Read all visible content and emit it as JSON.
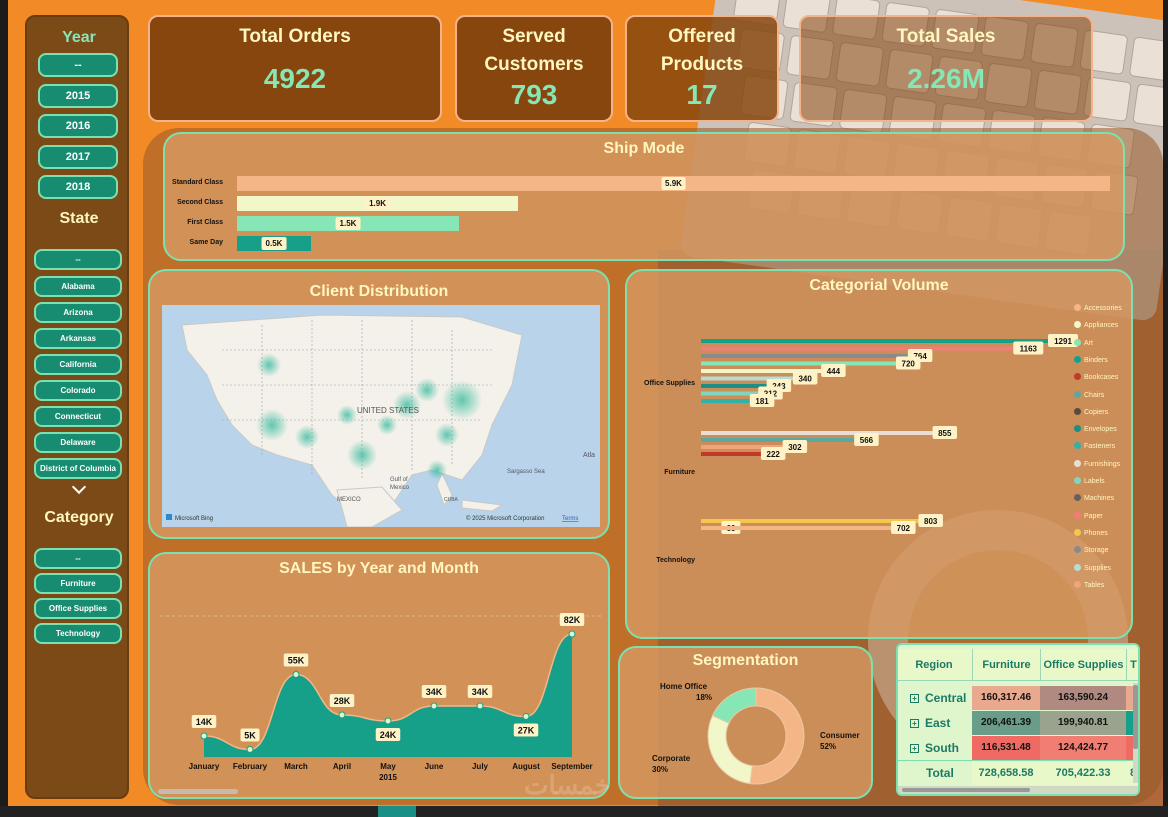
{
  "filters": {
    "year_title": "Year",
    "years": [
      "--",
      "2015",
      "2016",
      "2017",
      "2018"
    ],
    "state_title": "State",
    "states": [
      "--",
      "Alabama",
      "Arizona",
      "Arkansas",
      "California",
      "Colorado",
      "Connecticut",
      "Delaware",
      "District of Columbia"
    ],
    "category_title": "Category",
    "categories": [
      "--",
      "Furniture",
      "Office Supplies",
      "Technology"
    ]
  },
  "kpis": {
    "total_orders_label": "Total Orders",
    "total_orders_value": "4922",
    "served_customers_label": "Served Customers",
    "served_customers_value": "793",
    "offered_products_label": "Offered Products",
    "offered_products_value": "17",
    "total_sales_label": "Total Sales",
    "total_sales_value": "2.26M"
  },
  "ship_mode": {
    "title": "Ship Mode",
    "chart_data": {
      "type": "bar",
      "categories": [
        "Standard Class",
        "Second Class",
        "First Class",
        "Same Day"
      ],
      "values": [
        5900,
        1900,
        1500,
        500
      ],
      "data_labels": [
        "5.9K",
        "1.9K",
        "1.5K",
        "0.5K"
      ],
      "colors": [
        "#f5b687",
        "#f1f7c8",
        "#86e6b5",
        "#16a08a"
      ]
    }
  },
  "client_distribution": {
    "title": "Client Distribution",
    "map_labels": {
      "country": "UNITED STATES",
      "mexico": "MEXICO",
      "gulf": "Gulf of",
      "gulf2": "Mexico",
      "sea": "Sargasso Sea",
      "atlantic": "Atla",
      "cuba": "CUBA",
      "copyright": "© 2025 Microsoft Corporation",
      "terms": "Terms",
      "bing": "Microsoft Bing"
    }
  },
  "categorial_volume": {
    "title": "Categorial Volume",
    "chart_data": {
      "type": "bar",
      "categories": [
        "Office Supplies",
        "Furniture",
        "Technology"
      ],
      "series": [
        {
          "name": "Accessories",
          "color": "#f5b687",
          "values": [
            0,
            0,
            0
          ]
        },
        {
          "name": "Appliances",
          "color": "#f1f7c8",
          "values": [
            444,
            0,
            0
          ]
        },
        {
          "name": "Art",
          "color": "#86e6b5",
          "values": [
            720,
            0,
            0
          ]
        },
        {
          "name": "Binders",
          "color": "#16a08a",
          "values": [
            1291,
            0,
            0
          ]
        },
        {
          "name": "Bookcases",
          "color": "#c0392b",
          "values": [
            0,
            222,
            0
          ]
        },
        {
          "name": "Chairs",
          "color": "#5ba8a0",
          "values": [
            0,
            566,
            0
          ]
        },
        {
          "name": "Copiers",
          "color": "#5a4a3a",
          "values": [
            0,
            0,
            66
          ]
        },
        {
          "name": "Envelopes",
          "color": "#1a8f85",
          "values": [
            243,
            0,
            0
          ]
        },
        {
          "name": "Fasteners",
          "color": "#2fb3a5",
          "values": [
            181,
            0,
            0
          ]
        },
        {
          "name": "Furnishings",
          "color": "#e9ddd5",
          "values": [
            0,
            855,
            0
          ]
        },
        {
          "name": "Labels",
          "color": "#7fd7c2",
          "values": [
            212,
            0,
            0
          ]
        },
        {
          "name": "Machines",
          "color": "#6b5f5a",
          "values": [
            0,
            0,
            0
          ]
        },
        {
          "name": "Paper",
          "color": "#f07e78",
          "values": [
            1163,
            0,
            0
          ]
        },
        {
          "name": "Phones",
          "color": "#f3c84a",
          "values": [
            0,
            0,
            803
          ]
        },
        {
          "name": "Storage",
          "color": "#8a8a8a",
          "values": [
            764,
            0,
            0
          ]
        },
        {
          "name": "Supplies",
          "color": "#b7dbd5",
          "values": [
            340,
            0,
            0
          ]
        },
        {
          "name": "Tables",
          "color": "#f3a37a",
          "values": [
            0,
            302,
            0
          ]
        }
      ],
      "office_labels": [
        "1291",
        "1163",
        "764",
        "720",
        "444",
        "340",
        "243",
        "212",
        "181"
      ],
      "furniture_labels": [
        "855",
        "566",
        "302",
        "222"
      ],
      "technology_labels": [
        "803",
        "702",
        "66"
      ]
    }
  },
  "sales_by_month": {
    "title": "SALES by Year and Month",
    "chart_data": {
      "type": "area",
      "categories": [
        "January",
        "February",
        "March",
        "April",
        "May",
        "June",
        "July",
        "August",
        "September"
      ],
      "values": [
        14,
        5,
        55,
        28,
        24,
        34,
        34,
        27,
        82
      ],
      "data_labels": [
        "14K",
        "5K",
        "55K",
        "28K",
        "24K",
        "34K",
        "34K",
        "27K",
        "82K"
      ],
      "year_label": "2015",
      "ylim": [
        0,
        90
      ]
    }
  },
  "segmentation": {
    "title": "Segmentation",
    "chart_data": {
      "type": "pie",
      "categories": [
        "Consumer",
        "Corporate",
        "Home Office"
      ],
      "values": [
        52,
        30,
        18
      ],
      "colors": [
        "#f5b687",
        "#f1f7c8",
        "#86e6b5"
      ],
      "labels": [
        "52%",
        "30%",
        "18%"
      ]
    }
  },
  "region_table": {
    "columns": [
      "Region",
      "Furniture",
      "Office Supplies",
      "T"
    ],
    "rows": [
      {
        "region": "Central",
        "furniture": "160,317.46",
        "office": "163,590.24"
      },
      {
        "region": "East",
        "furniture": "206,461.39",
        "office": "199,940.81"
      },
      {
        "region": "South",
        "furniture": "116,531.48",
        "office": "124,424.77"
      }
    ],
    "total": {
      "region": "Total",
      "furniture": "728,658.58",
      "office": "705,422.33",
      "t": "8"
    },
    "plus": "+"
  },
  "watermark": "خمسات"
}
